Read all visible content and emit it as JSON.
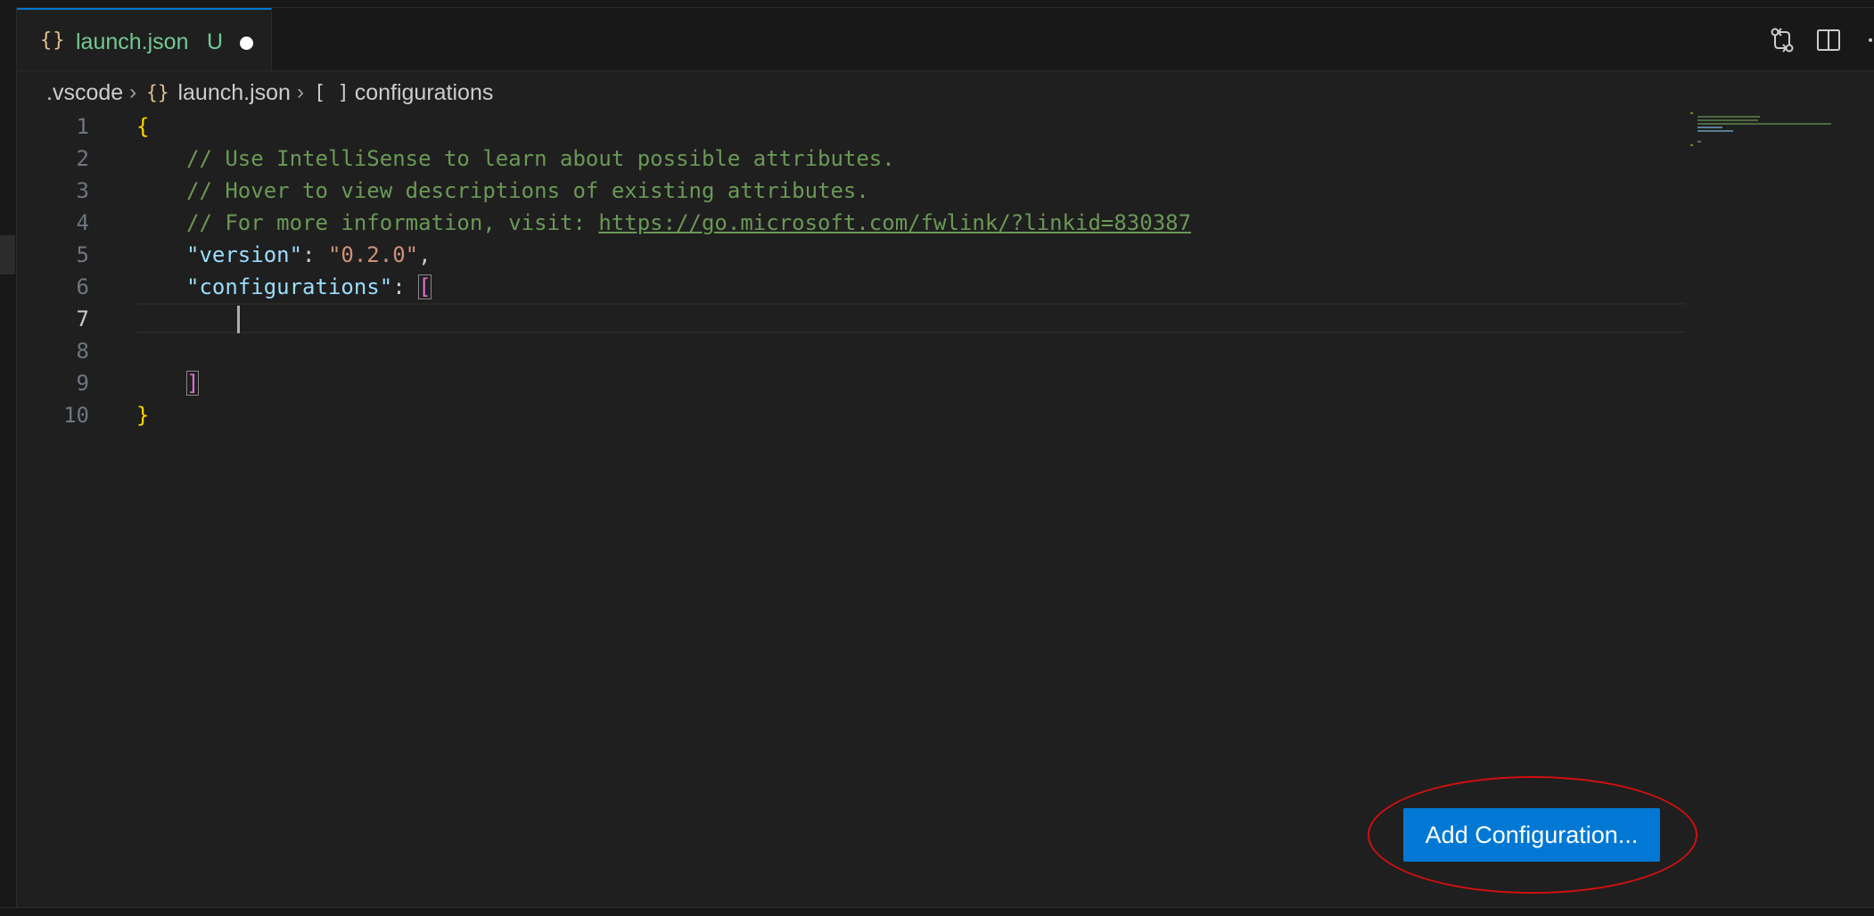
{
  "tab": {
    "icon": "json-braces-icon",
    "icon_text": "{}",
    "title": "launch.json",
    "status": "U",
    "dirty": true
  },
  "editor_actions": [
    {
      "icon": "git-compare-icon"
    },
    {
      "icon": "split-editor-icon"
    },
    {
      "icon": "more-actions-icon"
    }
  ],
  "breadcrumb": {
    "folder": ".vscode",
    "file_icon_text": "{}",
    "file": "launch.json",
    "symbol_icon_text": "[ ]",
    "symbol": "configurations"
  },
  "code": {
    "line_numbers": [
      "1",
      "2",
      "3",
      "4",
      "5",
      "6",
      "7",
      "8",
      "9",
      "10"
    ],
    "active_line": "7",
    "open_brace": "{",
    "comment_1": "// Use IntelliSense to learn about possible attributes.",
    "comment_2": "// Hover to view descriptions of existing attributes.",
    "comment_3_prefix": "// For more information, visit: ",
    "comment_3_link": "https://go.microsoft.com/fwlink/?linkid=830387",
    "version_key": "\"version\"",
    "version_colon": ": ",
    "version_value": "\"0.2.0\"",
    "version_comma": ",",
    "configurations_key": "\"configurations\"",
    "configurations_colon": ": ",
    "open_bracket": "[",
    "close_bracket": "]",
    "close_brace": "}"
  },
  "add_configuration_button": {
    "label": "Add Configuration..."
  },
  "colors": {
    "accent": "#0078d4",
    "highlight_annotation": "#d30f0f",
    "untracked_file": "#73c991"
  }
}
